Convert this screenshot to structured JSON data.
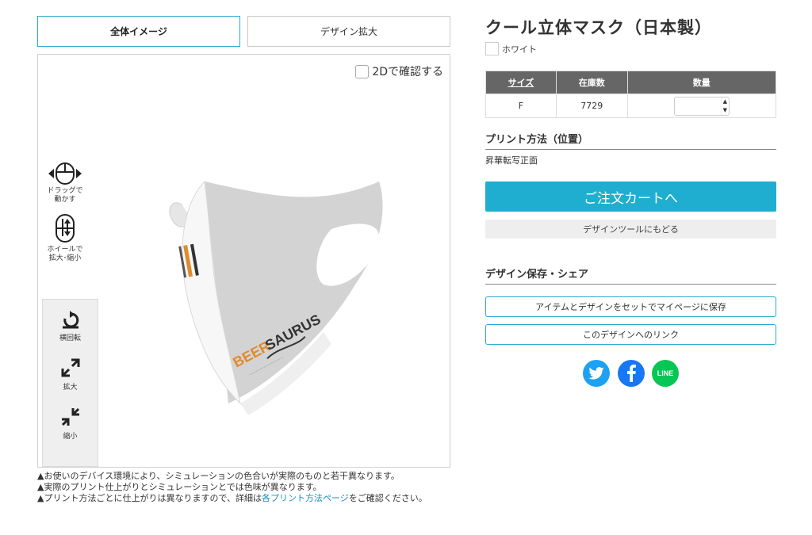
{
  "tabs": {
    "full_image": "全体イメージ",
    "design_zoom": "デザイン拡大"
  },
  "viewer": {
    "check_2d_label": "2Dで確認する",
    "help_drag": [
      "ドラッグで",
      "動かす"
    ],
    "help_wheel": [
      "ホイールで",
      "拡大･縮小"
    ],
    "controls": {
      "rotate": "横回転",
      "zoom_in": "拡大",
      "zoom_out": "縮小"
    },
    "mask_print_text": "BEERSAURUS"
  },
  "notes": {
    "note1": "お使いのデバイス環境により、シミュレーションの色合いが実際のものと若干異なります。",
    "note2": "実際のプリント仕上がりとシミュレーションとでは色味が異なります。",
    "note3_before": "プリント方法ごとに仕上がりは異なりますので、詳細は",
    "note3_link": "各プリント方法ページ",
    "note3_after": "をご確認ください。"
  },
  "product": {
    "title": "クール立体マスク（日本製）",
    "color_name": "ホワイト",
    "table": {
      "headers": [
        "サイズ",
        "在庫数",
        "数量"
      ],
      "rows": [
        {
          "size": "F",
          "stock": "7729",
          "quantity": ""
        }
      ]
    },
    "print_method_title": "プリント方法（位置）",
    "print_method_value": "昇華転写正面",
    "cart_button": "ご注文カートへ",
    "back_button": "デザインツールにもどる",
    "save_share_title": "デザイン保存・シェア",
    "save_button": "アイテムとデザインをセットでマイページに保存",
    "link_button": "このデザインへのリンク",
    "line_label": "LINE"
  },
  "colors": {
    "accent": "#1faed0",
    "twitter": "#1da1f2",
    "facebook": "#1877f2",
    "line": "#06c755",
    "print_orange": "#e08a2e"
  }
}
